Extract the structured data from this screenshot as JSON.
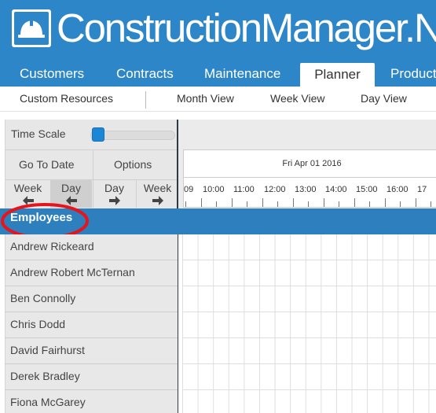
{
  "app": {
    "title": "ConstructionManager.NET"
  },
  "nav": {
    "tabs": [
      "Customers",
      "Contracts",
      "Maintenance",
      "Planner",
      "Products"
    ],
    "active": "Planner"
  },
  "subnav": {
    "items": [
      "Custom Resources",
      "Month View",
      "Week View",
      "Day View"
    ]
  },
  "controls": {
    "time_scale_label": "Time Scale",
    "time_scale_level": 0.06,
    "go_to_date": "Go To Date",
    "options": "Options",
    "nav_buttons": [
      {
        "label": "Week",
        "direction": "left"
      },
      {
        "label": "Day",
        "direction": "left"
      },
      {
        "label": "Day",
        "direction": "right"
      },
      {
        "label": "Week",
        "direction": "right"
      }
    ]
  },
  "timeline": {
    "date": "Fri Apr 01 2016",
    "hours": [
      "09",
      "10:00",
      "11:00",
      "12:00",
      "13:00",
      "14:00",
      "15:00",
      "16:00",
      "17"
    ]
  },
  "resources": {
    "group": "Employees",
    "employees": [
      "Andrew Rickeard",
      "Andrew Robert McTernan",
      "Ben Connolly",
      "Chris Dodd",
      "David Fairhurst",
      "Derek Bradley",
      "Fiona McGarey"
    ]
  },
  "colors": {
    "brand": "#2d86c8",
    "group_band": "#2d7fbd",
    "annotation": "#e8141b",
    "slider": "#1b86d6"
  },
  "icons": {
    "logo": "hard-hat-icon"
  }
}
